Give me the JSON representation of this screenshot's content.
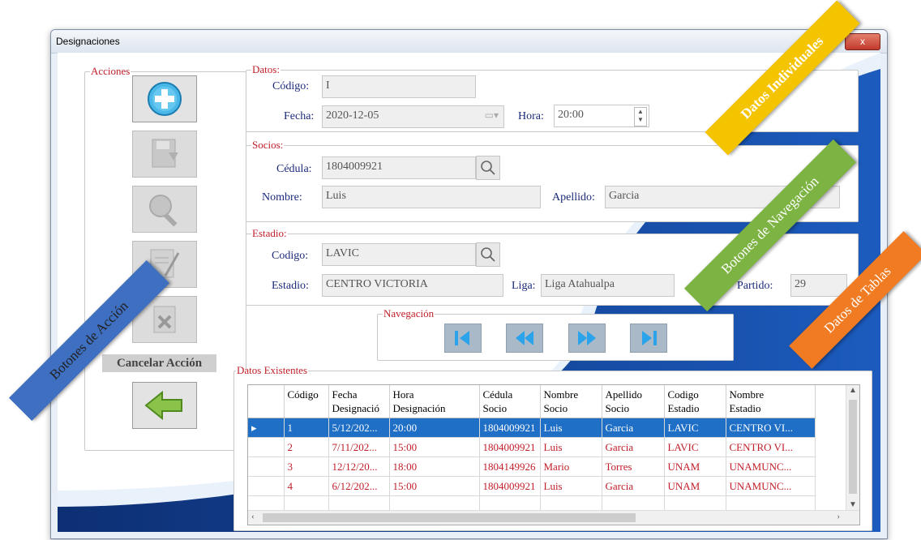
{
  "window": {
    "title": "Designaciones",
    "close": "x"
  },
  "acciones": {
    "legend": "Acciones",
    "cancel_label": "Cancelar Acción"
  },
  "datos": {
    "legend": "Datos:",
    "codigo_label": "Código:",
    "codigo_value": "I",
    "fecha_label": "Fecha:",
    "fecha_value": "2020-12-05",
    "hora_label": "Hora:",
    "hora_value": "20:00"
  },
  "socios": {
    "legend": "Socios:",
    "cedula_label": "Cédula:",
    "cedula_value": "1804009921",
    "nombre_label": "Nombre:",
    "nombre_value": "Luis",
    "apellido_label": "Apellido:",
    "apellido_value": "Garcia"
  },
  "estadio": {
    "legend": "Estadio:",
    "codigo_label": "Codigo:",
    "codigo_value": "LAVIC",
    "estadio_label": "Estadio:",
    "estadio_value": "CENTRO VICTORIA",
    "liga_label": "Liga:",
    "liga_value": "Liga Atahualpa",
    "partido_label": "Partido:",
    "partido_value": "29"
  },
  "navegacion": {
    "legend": "Navegación"
  },
  "tabla": {
    "legend": "Datos Existentes",
    "headers": [
      [
        "Código",
        ""
      ],
      [
        "Fecha",
        "Designació"
      ],
      [
        "Hora",
        "Designación"
      ],
      [
        "Cédula",
        "Socio"
      ],
      [
        "Nombre",
        "Socio"
      ],
      [
        "Apellido",
        "Socio"
      ],
      [
        "Codigo",
        "Estadio"
      ],
      [
        "Nombre",
        "Estadio"
      ]
    ],
    "rows": [
      [
        "1",
        "5/12/202...",
        "20:00",
        "1804009921",
        "Luis",
        "Garcia",
        "LAVIC",
        "CENTRO VI..."
      ],
      [
        "2",
        "7/11/202...",
        "15:00",
        "1804009921",
        "Luis",
        "Garcia",
        "LAVIC",
        "CENTRO VI..."
      ],
      [
        "3",
        "12/12/20...",
        "18:00",
        "1804149926",
        "Mario",
        "Torres",
        "UNAM",
        "UNAMUNC..."
      ],
      [
        "4",
        "6/12/202...",
        "15:00",
        "1804009921",
        "Luis",
        "Garcia",
        "UNAM",
        "UNAMUNC..."
      ]
    ]
  },
  "banners": {
    "datos_individuales": "Datos Individuales",
    "botones_navegacion": "Botones de Navegación",
    "datos_tablas": "Datos de Tablas",
    "botones_accion": "Botones de Acción"
  },
  "colors": {
    "yellow": "#f5c400",
    "green": "#7cb342",
    "orange": "#f07b22",
    "blue": "#3e6fc0",
    "label_red": "#c0202a",
    "label_navy": "#1b2a7a",
    "selection": "#1f6fc6"
  }
}
